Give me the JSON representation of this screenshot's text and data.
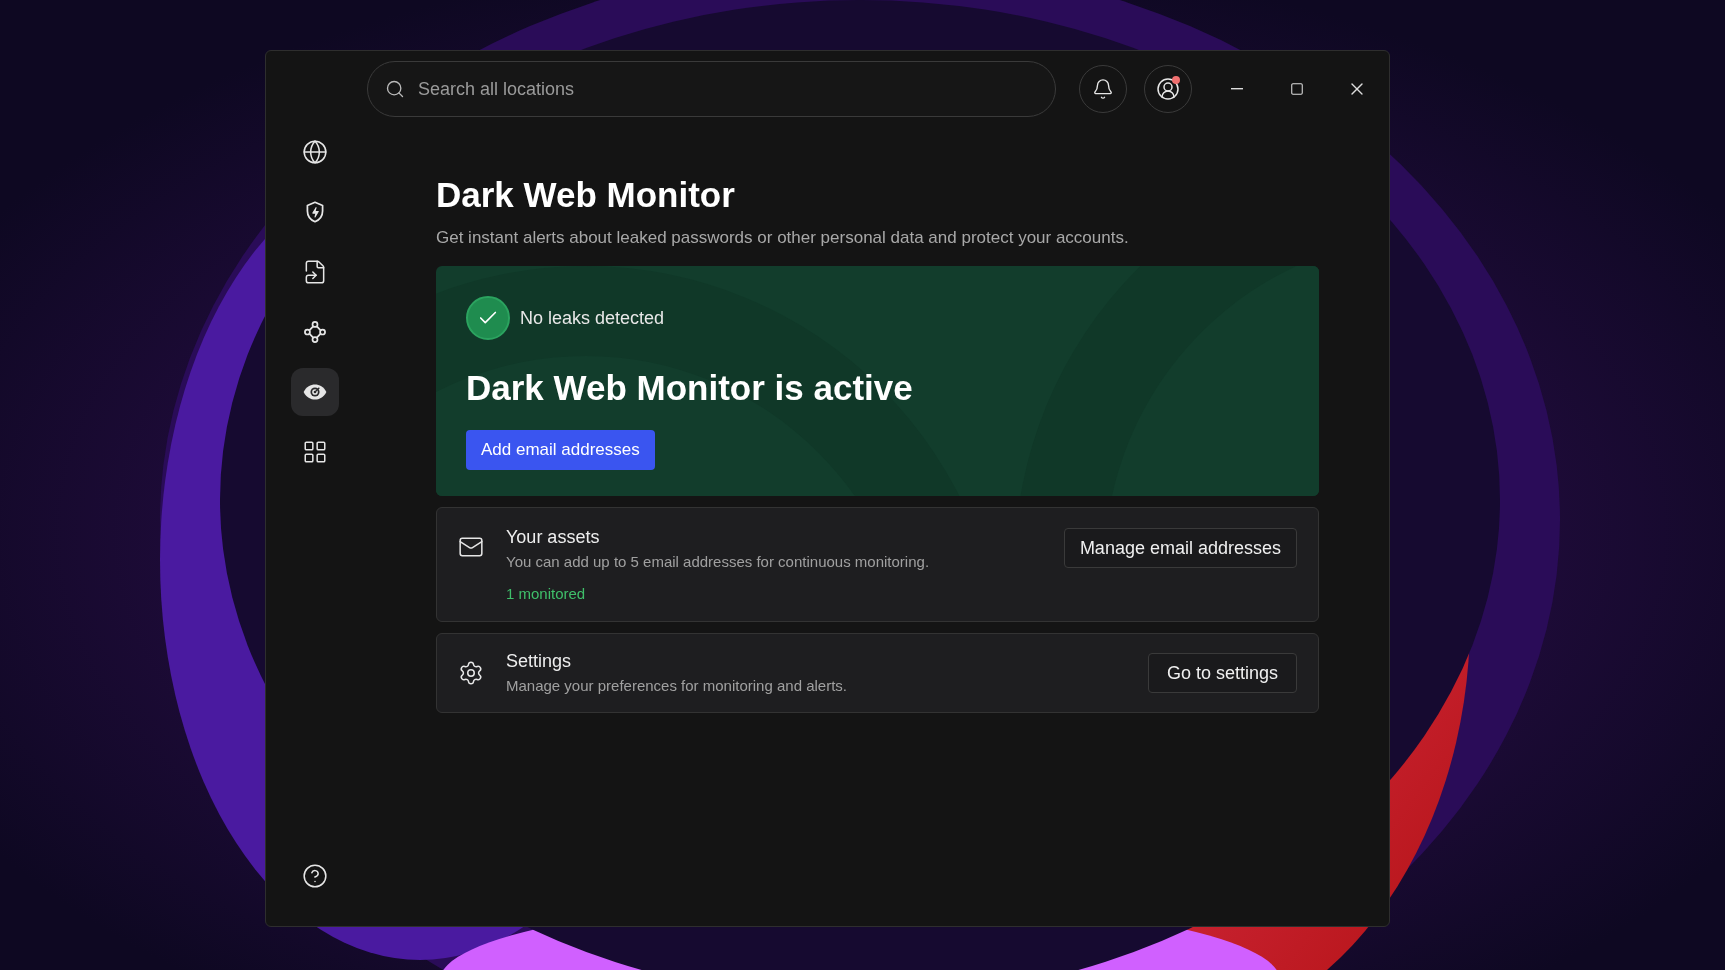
{
  "search": {
    "placeholder": "Search all locations"
  },
  "account": {
    "has_notification": true
  },
  "sidebar": {
    "items": [
      {
        "selected": false
      },
      {
        "selected": false
      },
      {
        "selected": false
      },
      {
        "selected": false
      },
      {
        "selected": true
      },
      {
        "selected": false
      }
    ]
  },
  "page": {
    "title": "Dark Web Monitor",
    "subtitle": "Get instant alerts about leaked passwords or other personal data and protect your accounts."
  },
  "status_card": {
    "status": "No leaks detected",
    "ok": true,
    "headline": "Dark Web Monitor is active",
    "button": "Add email addresses"
  },
  "assets": {
    "title": "Your assets",
    "description": "You can add up to 5 email addresses for continuous monitoring.",
    "count": "1 monitored",
    "button": "Manage email addresses"
  },
  "settings": {
    "title": "Settings",
    "description": "Manage your preferences for monitoring and alerts.",
    "button": "Go to settings"
  }
}
